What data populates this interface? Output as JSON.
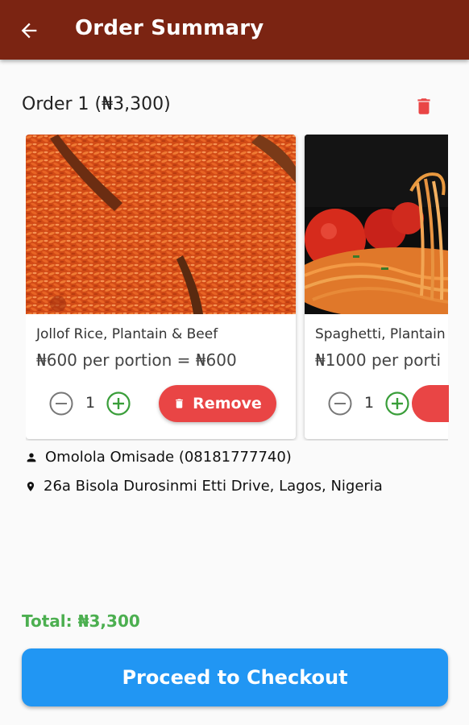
{
  "appbar": {
    "title": "Order Summary",
    "back_icon": "arrow-left-icon",
    "background": "#7b2412"
  },
  "order": {
    "header": "Order 1 (₦3,300)",
    "delete_icon": "trash-icon",
    "items": [
      {
        "name": "Jollof Rice, Plantain & Beef",
        "price_line": "₦600 per portion = ₦600",
        "quantity": "1",
        "remove_label": "Remove"
      },
      {
        "name": "Spaghetti, Plantain",
        "price_line": "₦1000 per porti",
        "quantity": "1"
      }
    ]
  },
  "customer": {
    "name_line": "Omolola Omisade (08181777740)",
    "address_line": "26a Bisola Durosinmi Etti Drive, Lagos, Nigeria",
    "person_icon": "person-icon",
    "location_icon": "location-pin-icon"
  },
  "footer": {
    "total": "Total: ₦3,300",
    "checkout_label": "Proceed to Checkout"
  },
  "colors": {
    "accent_red": "#e94545",
    "accent_green": "#4caf50",
    "accent_blue": "#2196f3"
  }
}
